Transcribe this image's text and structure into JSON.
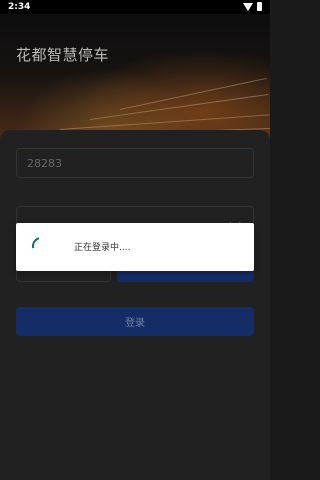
{
  "status_bar": {
    "time": "2:34",
    "wifi_icon": "wifi-icon",
    "battery_icon": "battery-icon"
  },
  "header": {
    "app_title": "花都智慧停车"
  },
  "login_form": {
    "account_value": "28283",
    "password_value": "",
    "login_label": "登录"
  },
  "dialog": {
    "loading_text": "正在登录中....",
    "spinner_color": "#0f6e6a"
  },
  "colors": {
    "primary": "#1d3f8f",
    "overlay": "rgba(0,0,0,0.28)"
  }
}
